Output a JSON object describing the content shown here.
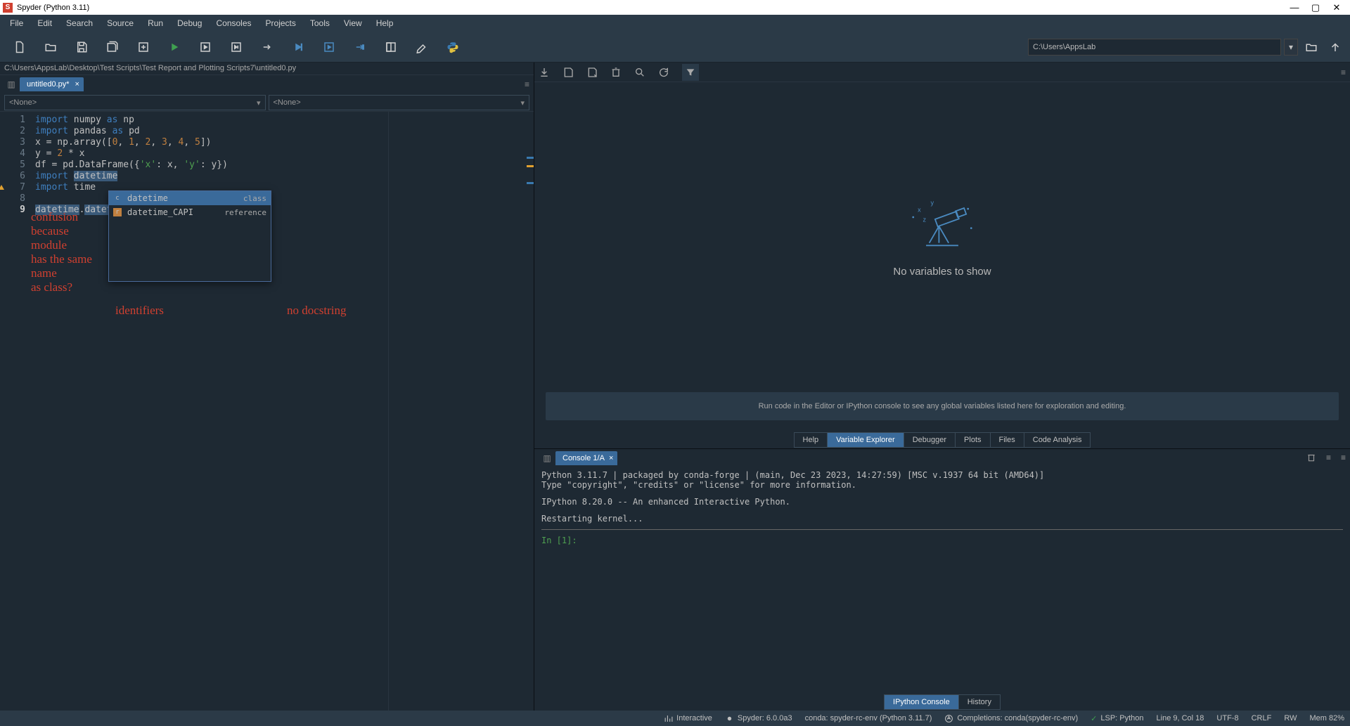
{
  "window": {
    "title": "Spyder (Python 3.11)"
  },
  "menu": [
    "File",
    "Edit",
    "Search",
    "Source",
    "Run",
    "Debug",
    "Consoles",
    "Projects",
    "Tools",
    "View",
    "Help"
  ],
  "cwd": "C:\\Users\\AppsLab",
  "breadcrumb": "C:\\Users\\AppsLab\\Desktop\\Test Scripts\\Test Report and Plotting Scripts7\\untitled0.py",
  "editor_tab": "untitled0.py*",
  "outline_left": "<None>",
  "outline_right": "<None>",
  "code": {
    "lines": [
      {
        "n": "1",
        "parts": [
          {
            "c": "kw",
            "t": "import"
          },
          {
            "c": "id2",
            "t": " numpy "
          },
          {
            "c": "kw",
            "t": "as"
          },
          {
            "c": "id2",
            "t": " np"
          }
        ]
      },
      {
        "n": "2",
        "parts": [
          {
            "c": "kw",
            "t": "import"
          },
          {
            "c": "id2",
            "t": " pandas "
          },
          {
            "c": "kw",
            "t": "as"
          },
          {
            "c": "id2",
            "t": " pd"
          }
        ]
      },
      {
        "n": "3",
        "parts": [
          {
            "c": "id2",
            "t": "x = np.array(["
          },
          {
            "c": "num",
            "t": "0"
          },
          {
            "c": "id2",
            "t": ", "
          },
          {
            "c": "num",
            "t": "1"
          },
          {
            "c": "id2",
            "t": ", "
          },
          {
            "c": "num",
            "t": "2"
          },
          {
            "c": "id2",
            "t": ", "
          },
          {
            "c": "num",
            "t": "3"
          },
          {
            "c": "id2",
            "t": ", "
          },
          {
            "c": "num",
            "t": "4"
          },
          {
            "c": "id2",
            "t": ", "
          },
          {
            "c": "num",
            "t": "5"
          },
          {
            "c": "id2",
            "t": "])"
          }
        ]
      },
      {
        "n": "4",
        "parts": [
          {
            "c": "id2",
            "t": "y = "
          },
          {
            "c": "num",
            "t": "2"
          },
          {
            "c": "id2",
            "t": " * x"
          }
        ]
      },
      {
        "n": "5",
        "parts": [
          {
            "c": "id2",
            "t": "df = pd.DataFrame({"
          },
          {
            "c": "str",
            "t": "'x'"
          },
          {
            "c": "id2",
            "t": ": x, "
          },
          {
            "c": "str",
            "t": "'y'"
          },
          {
            "c": "id2",
            "t": ": y})"
          }
        ]
      },
      {
        "n": "6",
        "parts": [
          {
            "c": "kw",
            "t": "import"
          },
          {
            "c": "id2",
            "t": " "
          },
          {
            "c": "hl",
            "t": "datetime"
          }
        ]
      },
      {
        "n": "7",
        "warn": true,
        "parts": [
          {
            "c": "kw",
            "t": "import"
          },
          {
            "c": "id2",
            "t": " time"
          }
        ]
      },
      {
        "n": "8",
        "parts": [
          {
            "c": "id2",
            "t": ""
          }
        ]
      },
      {
        "n": "9",
        "bold": true,
        "parts": [
          {
            "c": "hl",
            "t": "datetime"
          },
          {
            "c": "id2",
            "t": "."
          },
          {
            "c": "hl",
            "t": "datetime"
          }
        ]
      }
    ]
  },
  "autocomplete": [
    {
      "icon": "class",
      "name": "datetime",
      "type": "class",
      "sel": true
    },
    {
      "icon": "ref",
      "name": "datetime_CAPI",
      "type": "reference",
      "sel": false
    }
  ],
  "annotations": {
    "a1": "confusion\nbecause\nmodule\nhas the same\nname\nas class?",
    "a2": "identifiers",
    "a3": "no docstring"
  },
  "varexp": {
    "novar": "No variables to show",
    "hint": "Run code in the Editor or IPython console to see any global variables listed here for exploration and editing."
  },
  "right_tabs": [
    "Help",
    "Variable Explorer",
    "Debugger",
    "Plots",
    "Files",
    "Code Analysis"
  ],
  "right_tab_active": 1,
  "console_tab": "Console 1/A",
  "console_text": {
    "l1": "Python 3.11.7 | packaged by conda-forge | (main, Dec 23 2023, 14:27:59) [MSC v.1937 64 bit (AMD64)]",
    "l2": "Type \"copyright\", \"credits\" or \"license\" for more information.",
    "l3": "IPython 8.20.0 -- An enhanced Interactive Python.",
    "l4": "Restarting kernel...",
    "prompt": "In [1]:"
  },
  "console_tabs": [
    "IPython Console",
    "History"
  ],
  "console_tab_active": 0,
  "status": {
    "interactive": "Interactive",
    "spyder": "Spyder: 6.0.0a3",
    "conda": "conda: spyder-rc-env (Python 3.11.7)",
    "completions": "Completions: conda(spyder-rc-env)",
    "lsp": "LSP: Python",
    "linecol": "Line 9, Col 18",
    "enc": "UTF-8",
    "eol": "CRLF",
    "rw": "RW",
    "mem": "Mem 82%"
  }
}
